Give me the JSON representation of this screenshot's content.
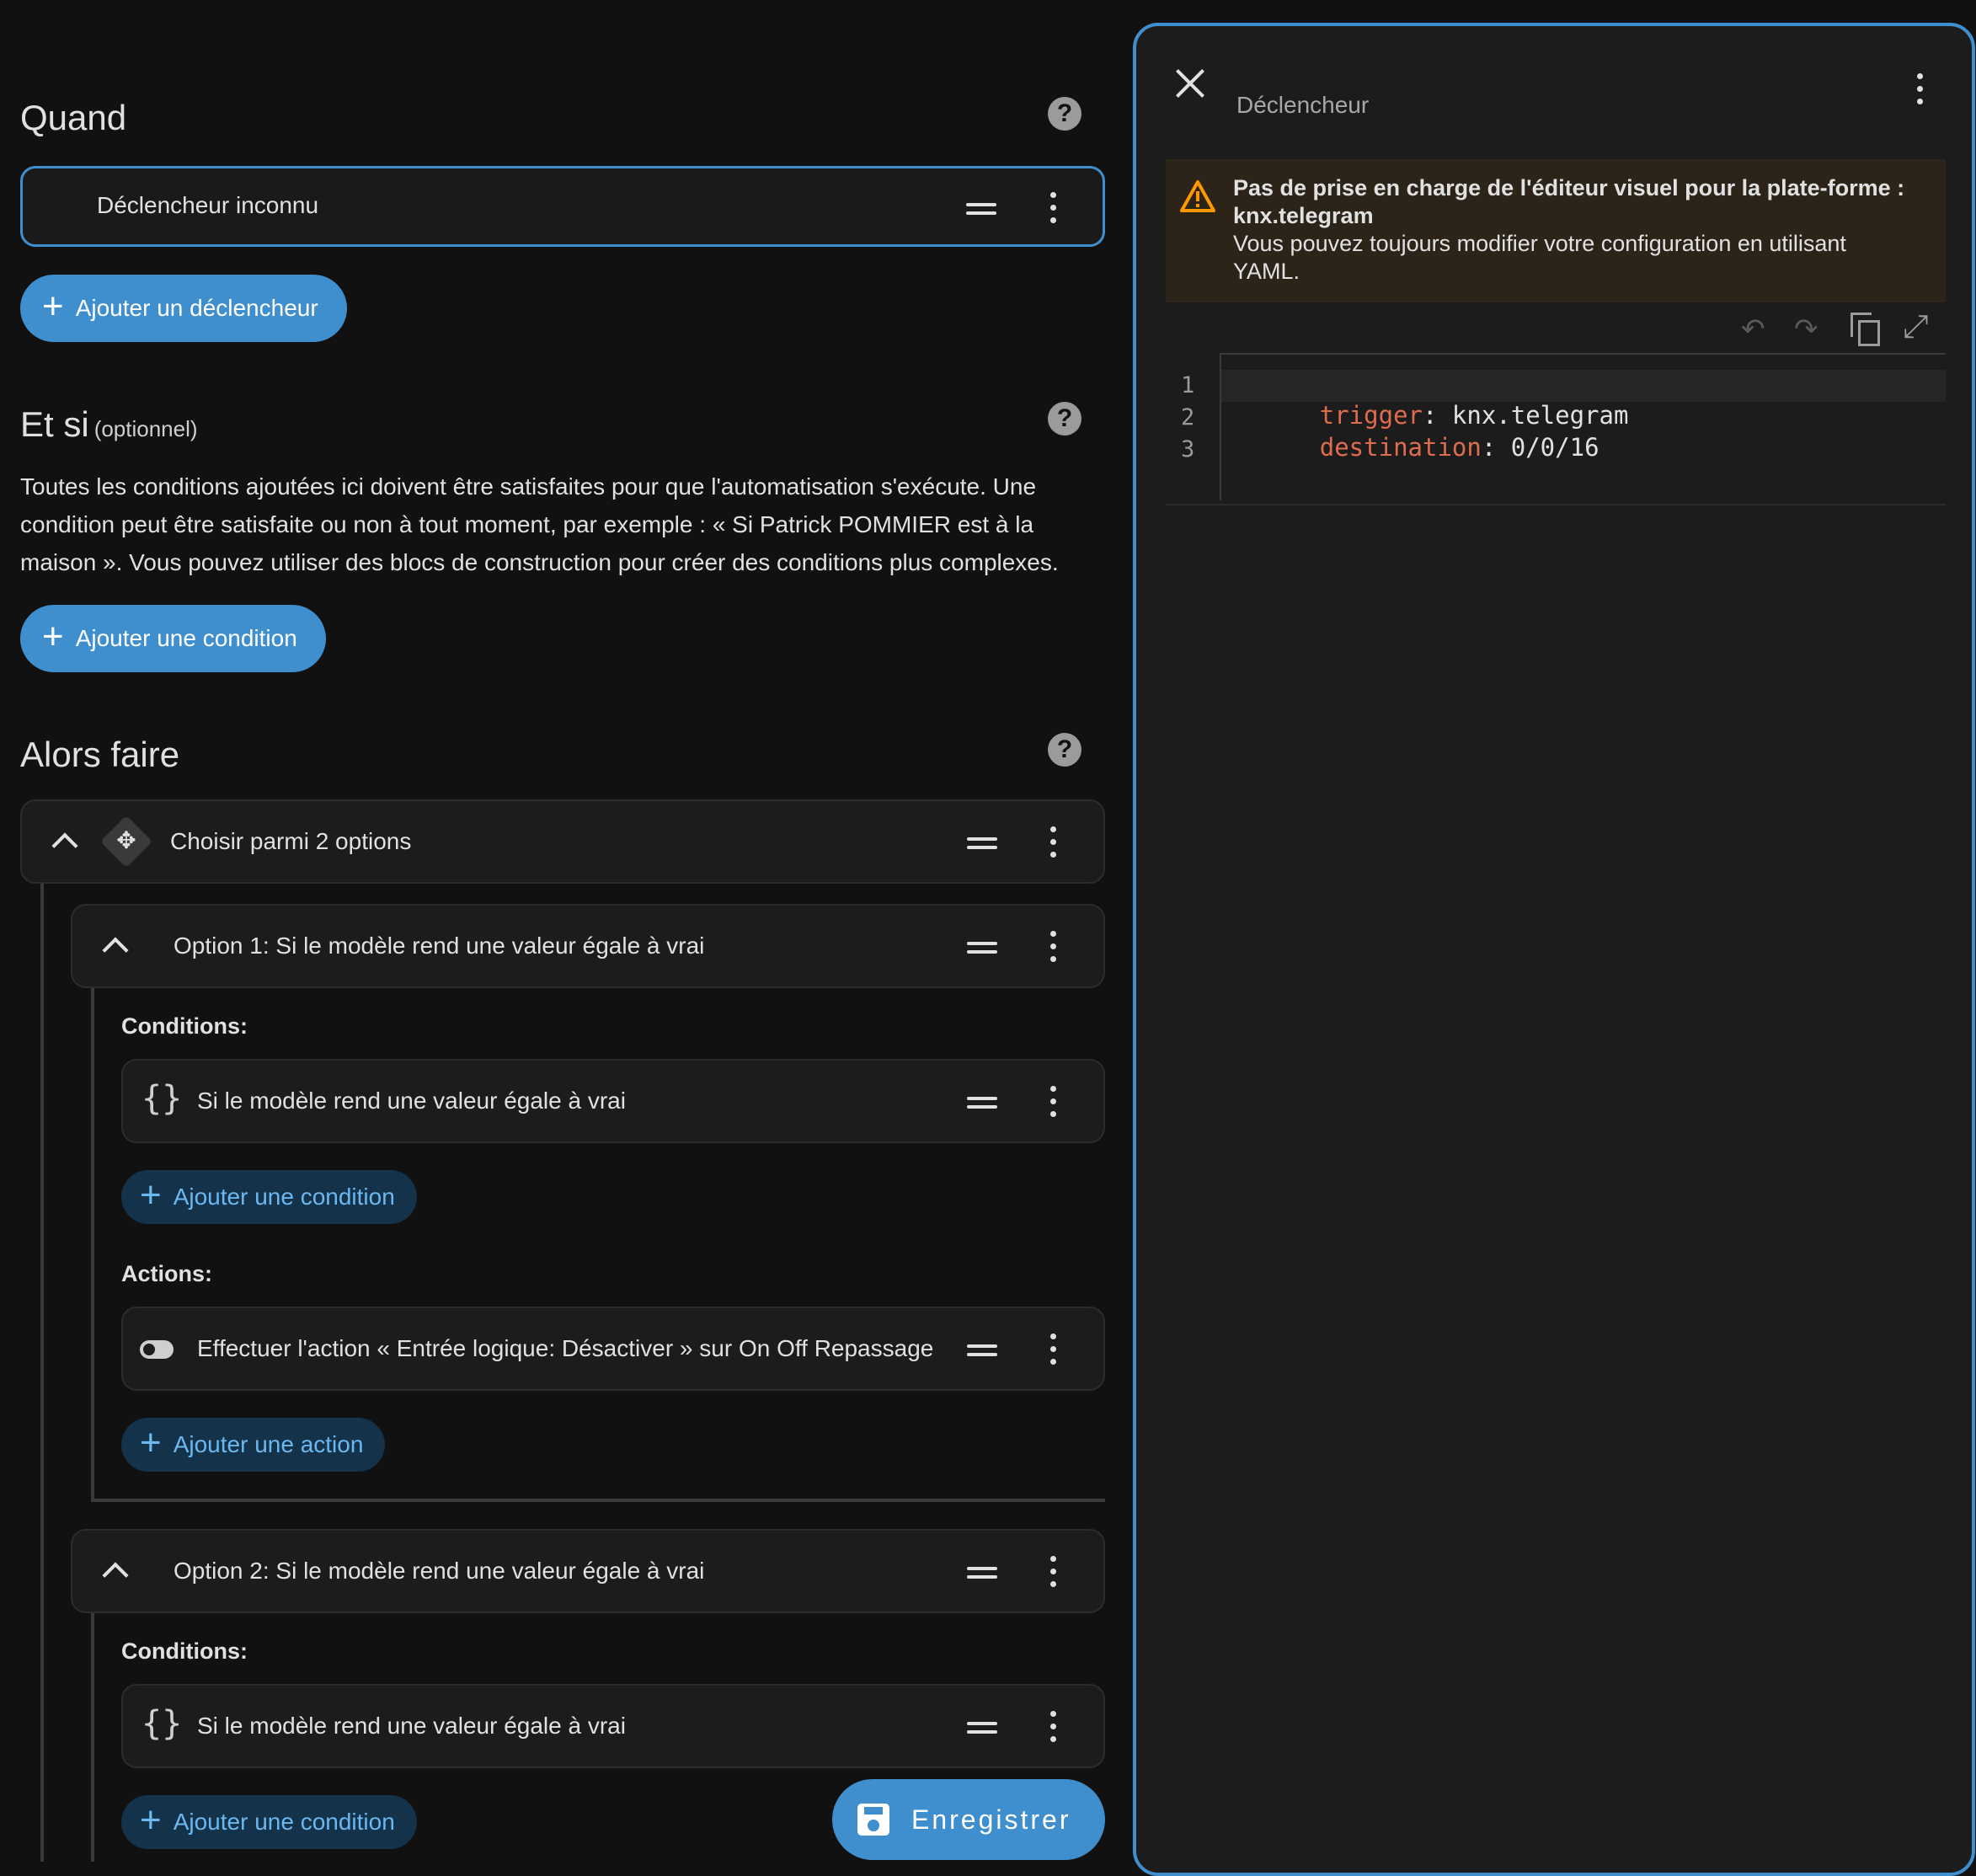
{
  "when": {
    "title": "Quand",
    "trigger_label": "Déclencheur inconnu",
    "add_trigger": "Ajouter un déclencheur"
  },
  "conditions": {
    "title": "Et si",
    "optional": "(optionnel)",
    "description_line1": "Toutes les conditions ajoutées ici doivent être satisfaites pour que l'automatisation s'exécute. Une",
    "description_line2": "condition peut être satisfaite ou non à tout moment, par exemple : « Si Patrick POMMIER est à la",
    "description_line3": "maison ». Vous pouvez utiliser des blocs de construction pour créer des conditions plus complexes.",
    "add_condition": "Ajouter une condition"
  },
  "actions": {
    "title": "Alors faire",
    "choose_label": "Choisir parmi 2 options",
    "option1": {
      "title": "Option 1: Si le modèle rend une valeur égale à vrai",
      "conditions_label": "Conditions:",
      "condition_text": "Si le modèle rend une valeur égale à vrai",
      "add_condition": "Ajouter une condition",
      "actions_label": "Actions:",
      "action_text": "Effectuer l'action « Entrée logique: Désactiver » sur On Off Repassage",
      "add_action": "Ajouter une action"
    },
    "option2": {
      "title": "Option 2: Si le modèle rend une valeur égale à vrai",
      "conditions_label": "Conditions:",
      "condition_text": "Si le modèle rend une valeur égale à vrai",
      "add_condition": "Ajouter une condition"
    }
  },
  "save_button": "Enregistrer",
  "panel": {
    "title": "Déclencheur",
    "warning_title_line1": "Pas de prise en charge de l'éditeur visuel pour la plate-forme :",
    "warning_title_line2": "knx.telegram",
    "warning_body_line1": "Vous pouvez toujours modifier votre configuration en utilisant",
    "warning_body_line2": "YAML.",
    "code": {
      "line_numbers": [
        "1",
        "2",
        "3"
      ],
      "line1_key": "trigger",
      "line1_value": "knx.telegram",
      "line2_key": "destination",
      "line2_value": "0/0/16",
      "colon": ":"
    }
  },
  "colors": {
    "accent": "#3f8fcf",
    "warning": "#ff9800",
    "yaml_key": "#e06c4f"
  }
}
